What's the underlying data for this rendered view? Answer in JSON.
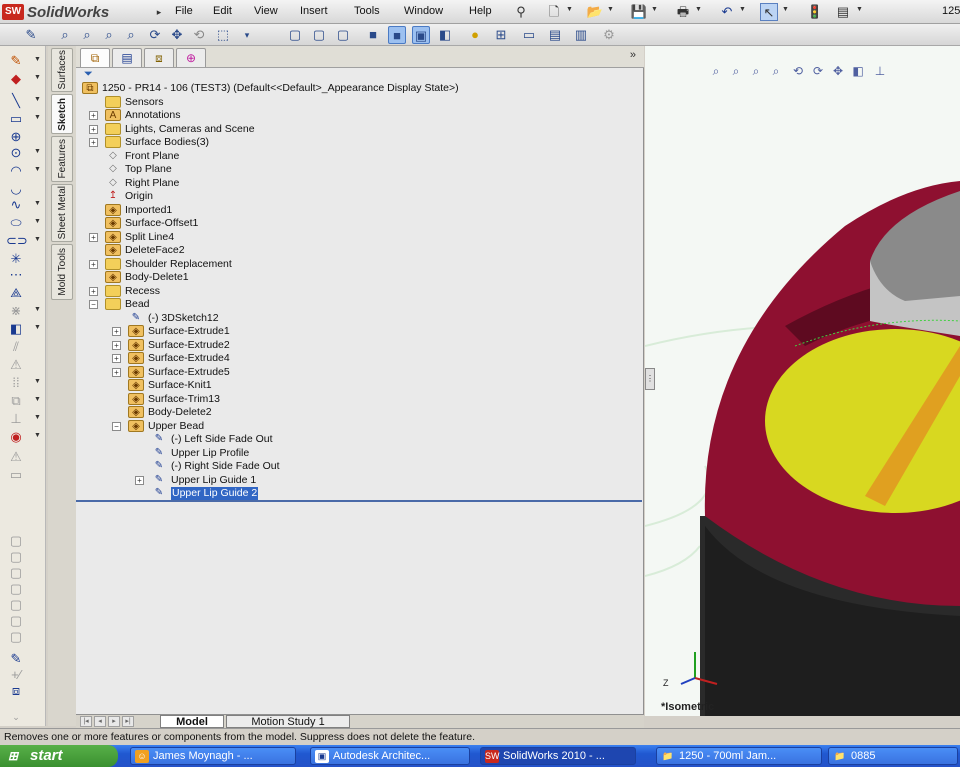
{
  "app": {
    "logo_badge": "SW",
    "name": "SolidWorks",
    "logo_arrow": "▸"
  },
  "menu": [
    "File",
    "Edit",
    "View",
    "Insert",
    "Tools",
    "Window",
    "Help"
  ],
  "menu_right_text": "125",
  "command_tabs": [
    "Surfaces",
    "Sketch",
    "Features",
    "Sheet Metal",
    "Mold Tools"
  ],
  "feature_manager": {
    "expand_glyph": "»",
    "filter_icon": "⏷",
    "tree": [
      {
        "label": "1250 - PR14 - 106  (TEST3)  (Default<<Default>_Appearance Display State>)",
        "indent": 0,
        "icon": "part",
        "expander": ""
      },
      {
        "label": "Sensors",
        "indent": 1,
        "icon": "folder",
        "expander": ""
      },
      {
        "label": "Annotations",
        "indent": 1,
        "icon": "annot",
        "expander": "+"
      },
      {
        "label": "Lights, Cameras and Scene",
        "indent": 1,
        "icon": "folder",
        "expander": "+"
      },
      {
        "label": "Surface Bodies(3)",
        "indent": 1,
        "icon": "folder",
        "expander": "+"
      },
      {
        "label": "Front Plane",
        "indent": 1,
        "icon": "plane",
        "expander": ""
      },
      {
        "label": "Top Plane",
        "indent": 1,
        "icon": "plane",
        "expander": ""
      },
      {
        "label": "Right Plane",
        "indent": 1,
        "icon": "plane",
        "expander": ""
      },
      {
        "label": "Origin",
        "indent": 1,
        "icon": "origin",
        "expander": ""
      },
      {
        "label": "Imported1",
        "indent": 1,
        "icon": "feat",
        "expander": ""
      },
      {
        "label": "Surface-Offset1",
        "indent": 1,
        "icon": "feat",
        "expander": ""
      },
      {
        "label": "Split Line4",
        "indent": 1,
        "icon": "feat",
        "expander": "+"
      },
      {
        "label": "DeleteFace2",
        "indent": 1,
        "icon": "feat",
        "expander": ""
      },
      {
        "label": "Shoulder Replacement",
        "indent": 1,
        "icon": "folder",
        "expander": "+"
      },
      {
        "label": "Body-Delete1",
        "indent": 1,
        "icon": "feat",
        "expander": ""
      },
      {
        "label": "Recess",
        "indent": 1,
        "icon": "folder",
        "expander": "+"
      },
      {
        "label": "Bead",
        "indent": 1,
        "icon": "folder",
        "expander": "−"
      },
      {
        "label": "(-) 3DSketch12",
        "indent": 2,
        "icon": "sketch",
        "expander": ""
      },
      {
        "label": "Surface-Extrude1",
        "indent": 2,
        "icon": "feat",
        "expander": "+"
      },
      {
        "label": "Surface-Extrude2",
        "indent": 2,
        "icon": "feat",
        "expander": "+"
      },
      {
        "label": "Surface-Extrude4",
        "indent": 2,
        "icon": "feat",
        "expander": "+"
      },
      {
        "label": "Surface-Extrude5",
        "indent": 2,
        "icon": "feat",
        "expander": "+"
      },
      {
        "label": "Surface-Knit1",
        "indent": 2,
        "icon": "feat",
        "expander": ""
      },
      {
        "label": "Surface-Trim13",
        "indent": 2,
        "icon": "feat",
        "expander": ""
      },
      {
        "label": "Body-Delete2",
        "indent": 2,
        "icon": "feat",
        "expander": ""
      },
      {
        "label": "Upper Bead",
        "indent": 2,
        "icon": "feat",
        "expander": "−"
      },
      {
        "label": "(-) Left Side Fade Out",
        "indent": 3,
        "icon": "sketch",
        "expander": ""
      },
      {
        "label": "Upper Lip Profile",
        "indent": 3,
        "icon": "sketch",
        "expander": ""
      },
      {
        "label": "(-) Right Side Fade Out",
        "indent": 3,
        "icon": "sketch",
        "expander": ""
      },
      {
        "label": "Upper Lip Guide 1",
        "indent": 3,
        "icon": "sketch",
        "expander": "+"
      },
      {
        "label": "Upper Lip Guide 2",
        "indent": 3,
        "icon": "sketch",
        "expander": "",
        "selected": true
      }
    ]
  },
  "bottom_tabs": [
    "Model",
    "Motion Study 1"
  ],
  "bottom_nav": [
    "|◂",
    "◂",
    "▸",
    "▸|"
  ],
  "splitter_glyph": "⋮",
  "view_label": "*Isometric",
  "status_text": "Removes one or more features or components from the model. Suppress does not delete the feature.",
  "taskbar": {
    "start_label": "start",
    "start_icon": "⊞",
    "tasks": [
      {
        "label": "James Moynagh - ...",
        "icon": "☺"
      },
      {
        "label": "Autodesk Architec...",
        "icon": "▣"
      },
      {
        "label": "SolidWorks 2010 - ...",
        "icon": "SW",
        "active": true
      },
      {
        "label": "1250 - 700ml Jam...",
        "icon": "📁"
      },
      {
        "label": "0885",
        "icon": "📁"
      }
    ]
  },
  "colors": {
    "selection": "#3166c4",
    "model_red": "#8e1030",
    "model_yellow": "#d8d820",
    "model_dark": "#2a2a2a",
    "viewport_bg": "#f4f8f4"
  }
}
